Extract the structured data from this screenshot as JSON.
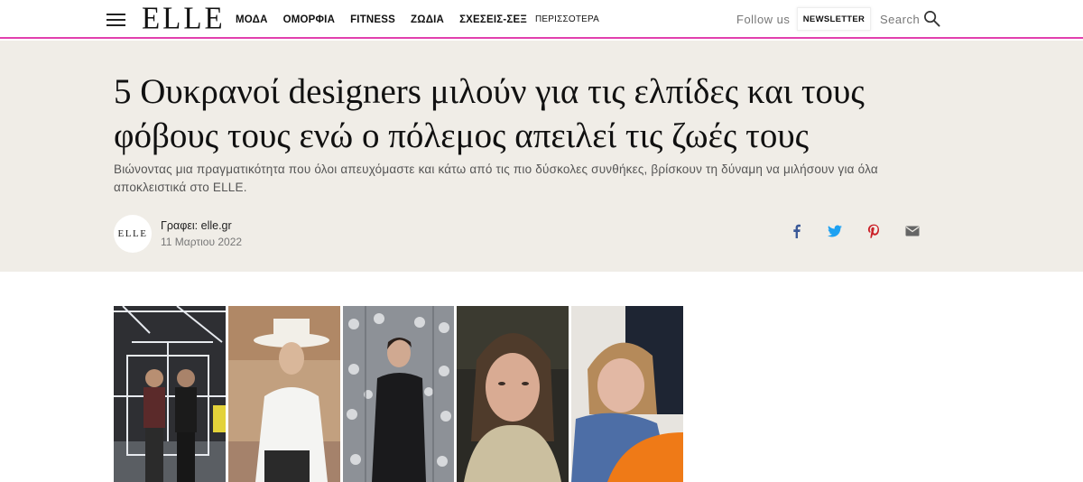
{
  "header": {
    "logo": "ELLE",
    "nav": [
      "ΜΟΔΑ",
      "ΟΜΟΡΦΙΑ",
      "FITNESS",
      "ΖΩΔΙΑ",
      "ΣΧΕΣΕΙΣ-ΣΕΞ"
    ],
    "more_label": "ΠΕΡΙΣΣΟΤΕΡΑ",
    "follow_label": "Follow us",
    "newsletter_label": "NEWSLETTER",
    "search_label": "Search"
  },
  "article": {
    "title": "5 Ουκρανοί designers μιλούν για τις ελπίδες και τους φόβους τους ενώ ο πόλεμος απειλεί τις ζωές τους",
    "subtitle": "Βιώνοντας μια πραγματικότητα που όλοι απευχόμαστε και κάτω από τις πιο δύσκολες συνθήκες, βρίσκουν τη δύναμη να μιλήσουν για όλα αποκλειστικά στο ELLE.",
    "avatar_text": "ELLE",
    "author": "Γραφει: elle.gr",
    "date": "11 Μαρτιου 2022"
  },
  "share": [
    "facebook-icon",
    "twitter-icon",
    "pinterest-icon",
    "email-icon"
  ],
  "colors": {
    "accent": "#e23fae",
    "hero_bg": "#f0ede7",
    "facebook": "#3b5998",
    "twitter": "#1da1f2",
    "pinterest": "#cb2027",
    "email": "#666666"
  }
}
